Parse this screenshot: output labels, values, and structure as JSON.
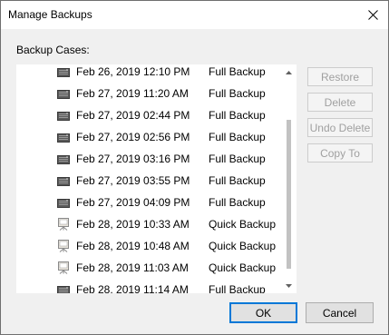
{
  "window": {
    "title": "Manage Backups"
  },
  "list": {
    "label": "Backup Cases:",
    "rows": [
      {
        "date": "Feb 26, 2019 12:10 PM",
        "type": "Full Backup",
        "icon": "full-backup-icon"
      },
      {
        "date": "Feb 27, 2019 11:20 AM",
        "type": "Full Backup",
        "icon": "full-backup-icon"
      },
      {
        "date": "Feb 27, 2019 02:44 PM",
        "type": "Full Backup",
        "icon": "full-backup-icon"
      },
      {
        "date": "Feb 27, 2019 02:56 PM",
        "type": "Full Backup",
        "icon": "full-backup-icon"
      },
      {
        "date": "Feb 27, 2019 03:16 PM",
        "type": "Full Backup",
        "icon": "full-backup-icon"
      },
      {
        "date": "Feb 27, 2019 03:55 PM",
        "type": "Full Backup",
        "icon": "full-backup-icon"
      },
      {
        "date": "Feb 27, 2019 04:09 PM",
        "type": "Full Backup",
        "icon": "full-backup-icon"
      },
      {
        "date": "Feb 28, 2019 10:33 AM",
        "type": "Quick Backup",
        "icon": "quick-backup-icon"
      },
      {
        "date": "Feb 28, 2019 10:48 AM",
        "type": "Quick Backup",
        "icon": "quick-backup-icon"
      },
      {
        "date": "Feb 28, 2019 11:03 AM",
        "type": "Quick Backup",
        "icon": "quick-backup-icon"
      },
      {
        "date": "Feb 28, 2019 11:14 AM",
        "type": "Full Backup",
        "icon": "full-backup-icon"
      }
    ]
  },
  "actions": {
    "restore": "Restore",
    "delete": "Delete",
    "undo_delete": "Undo Delete",
    "copy_to": "Copy To"
  },
  "footer": {
    "ok": "OK",
    "cancel": "Cancel"
  },
  "colors": {
    "window_bg": "#f0f0f0",
    "disabled_text": "#a0a0a0",
    "default_button_border": "#0078d7"
  }
}
